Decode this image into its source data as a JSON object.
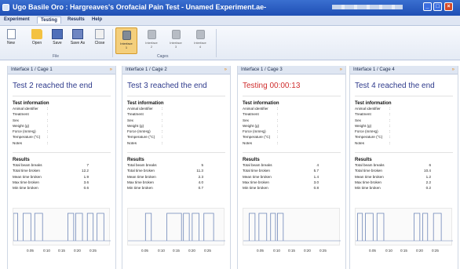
{
  "window": {
    "title": "Ugo Basile Oro : Hargreaves's Orofacial Pain Test - Unamed Experiment.ae-"
  },
  "menu": [
    "Experiment",
    "Testing",
    "Results",
    "Help"
  ],
  "ribbon": {
    "file_buttons": [
      "New",
      "Open",
      "Save",
      "Save As",
      "Close"
    ],
    "file_group_label": "File",
    "cage_buttons": [
      {
        "l1": "Interface",
        "l2": "1"
      },
      {
        "l1": "Interface",
        "l2": "2"
      },
      {
        "l1": "Interface",
        "l2": "3"
      },
      {
        "l1": "Interface",
        "l2": "4"
      }
    ],
    "cages_group_label": "Cages"
  },
  "panels": [
    {
      "header": "Interface 1 / Cage 1",
      "status": "Test 2 reached the end",
      "status_color": "#2f3b8c",
      "results": [
        "7",
        "12.2",
        "1.9",
        "3.6",
        "0.6"
      ],
      "pulses": [
        [
          0.0,
          0.045
        ],
        [
          0.1,
          0.18
        ],
        [
          0.22,
          0.3
        ],
        [
          0.56,
          0.62
        ],
        [
          0.64,
          0.71
        ],
        [
          0.76,
          0.82
        ],
        [
          0.86,
          0.93
        ]
      ]
    },
    {
      "header": "Interface 1 / Cage 2",
      "status": "Test 3 reached the end",
      "status_color": "#2f3b8c",
      "results": [
        "5",
        "11.3",
        "2.3",
        "4.0",
        "0.7"
      ],
      "pulses": [
        [
          0.18,
          0.24
        ],
        [
          0.4,
          0.55
        ],
        [
          0.57,
          0.63
        ],
        [
          0.66,
          0.73
        ],
        [
          0.78,
          0.88
        ]
      ]
    },
    {
      "header": "Interface 1 / Cage 3",
      "status": "Testing 00:00:13",
      "status_color": "#cf2d2d",
      "results": [
        "4",
        "5.7",
        "1.4",
        "3.0",
        "0.8"
      ],
      "pulses": [
        [
          0.06,
          0.12
        ],
        [
          0.16,
          0.24
        ],
        [
          0.28,
          0.33
        ],
        [
          0.35,
          0.41
        ]
      ]
    },
    {
      "header": "Interface 1 / Cage 4",
      "status": "Test 4 reached the end",
      "status_color": "#2f3b8c",
      "results": [
        "6",
        "10.4",
        "1.2",
        "2.2",
        "0.2"
      ],
      "pulses": [
        [
          0.02,
          0.07
        ],
        [
          0.1,
          0.18
        ],
        [
          0.22,
          0.29
        ],
        [
          0.6,
          0.66
        ],
        [
          0.69,
          0.74
        ],
        [
          0.8,
          0.88
        ]
      ]
    }
  ],
  "test_info": {
    "title": "Test information",
    "labels": [
      "Animal identifier",
      "Treatment",
      "Sex",
      "Weight (g)",
      "Force (mmHg)",
      "Temperature (°C)",
      "Notes"
    ]
  },
  "results_info": {
    "title": "Results",
    "labels": [
      "Total beam breaks",
      "Total time broken",
      "Mean time broken",
      "Max time broken",
      "Min time broken"
    ]
  },
  "x_ticks": [
    "0.05",
    "0:10",
    "0:15",
    "0:20",
    "0:25"
  ],
  "colors": {
    "accent": "#2f3b8c",
    "testing": "#cf2d2d",
    "arrow": "#e38a1c",
    "graph_line": "#6e86b8"
  }
}
